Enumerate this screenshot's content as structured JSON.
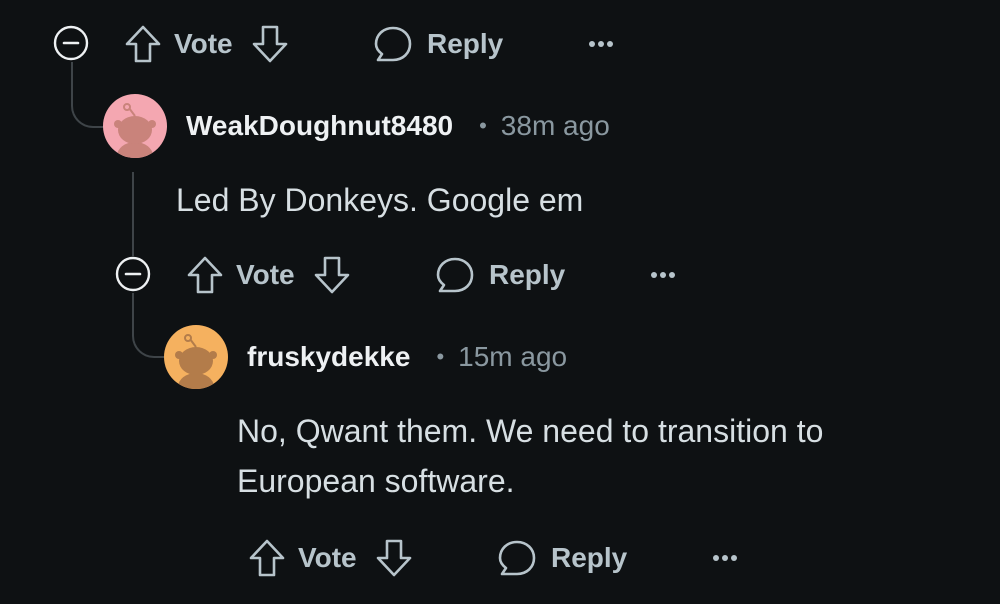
{
  "actions": {
    "vote_label": "Vote",
    "reply_label": "Reply"
  },
  "comments": [
    {
      "username": "WeakDoughnut8480",
      "separator": "•",
      "time": "38m ago",
      "body": "Led By Donkeys. Google em",
      "avatar_color": "#f4a7b1"
    },
    {
      "username": "fruskydekke",
      "separator": "•",
      "time": "15m ago",
      "body_line1": "No, Qwant them. We need to transition to",
      "body_line2": "European software.",
      "avatar_color": "#f5b15f"
    }
  ],
  "icons": {
    "collapse": "minus-circle-icon",
    "upvote": "arrow-up-icon",
    "downvote": "arrow-down-icon",
    "reply": "speech-bubble-icon",
    "more": "ellipsis-icon"
  }
}
